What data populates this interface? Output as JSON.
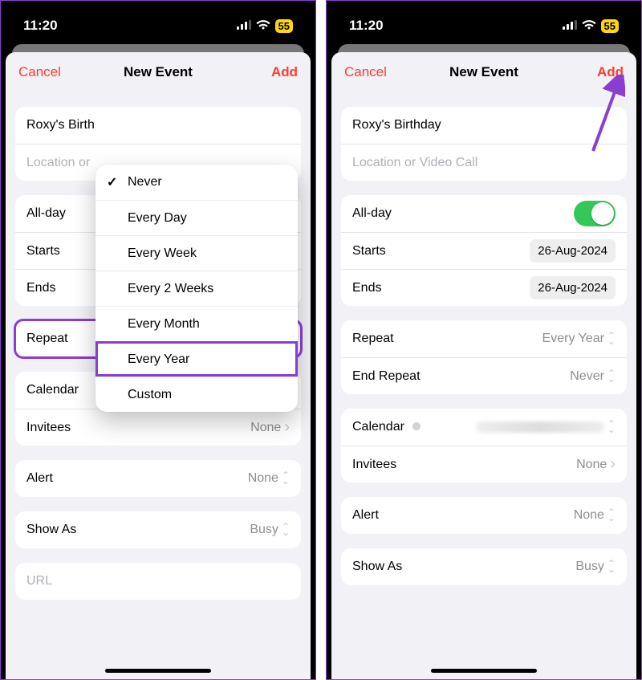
{
  "status": {
    "time": "11:20",
    "battery": "55"
  },
  "nav": {
    "cancel": "Cancel",
    "title": "New Event",
    "add": "Add"
  },
  "event": {
    "title": "Roxy's Birthday",
    "title_short": "Roxy's Birth",
    "location_placeholder": "Location or Video Call",
    "location_placeholder_short": "Location or"
  },
  "labels": {
    "allday": "All-day",
    "starts": "Starts",
    "ends": "Ends",
    "repeat": "Repeat",
    "end_repeat": "End Repeat",
    "calendar": "Calendar",
    "invitees": "Invitees",
    "alert": "Alert",
    "showas": "Show As",
    "url": "URL"
  },
  "values": {
    "date": "26-Aug-2024",
    "repeat_p1": "Never",
    "repeat_p2": "Every Year",
    "end_repeat": "Never",
    "invitees": "None",
    "alert": "None",
    "showas": "Busy"
  },
  "menu": {
    "items": [
      "Never",
      "Every Day",
      "Every Week",
      "Every 2 Weeks",
      "Every Month",
      "Every Year",
      "Custom"
    ],
    "selected": "Never",
    "highlighted": "Every Year"
  }
}
